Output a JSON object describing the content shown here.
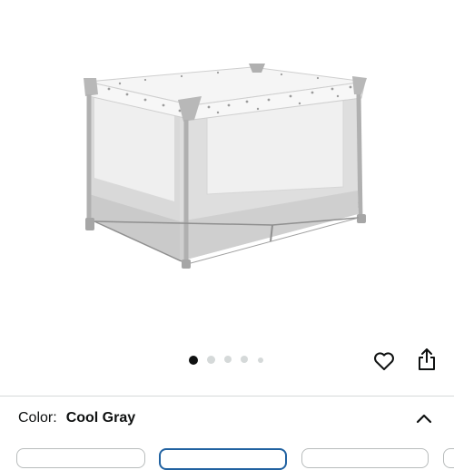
{
  "gallery": {
    "image_alt": "Gray play yard with white patterned canopy",
    "slide_count": 5,
    "active_slide": 1
  },
  "actions": {
    "favorite_icon": "heart-icon",
    "share_icon": "share-icon"
  },
  "variation": {
    "label": "Color:",
    "selected_value": "Cool Gray",
    "toggle_icon": "chevron-up-icon"
  },
  "colors": {
    "frame": "#c9c9c9",
    "canopy": "#f3f3f3",
    "selected_border": "#2162a1",
    "active_dot": "#0f1111",
    "inactive_dot": "#d5d9d9"
  }
}
